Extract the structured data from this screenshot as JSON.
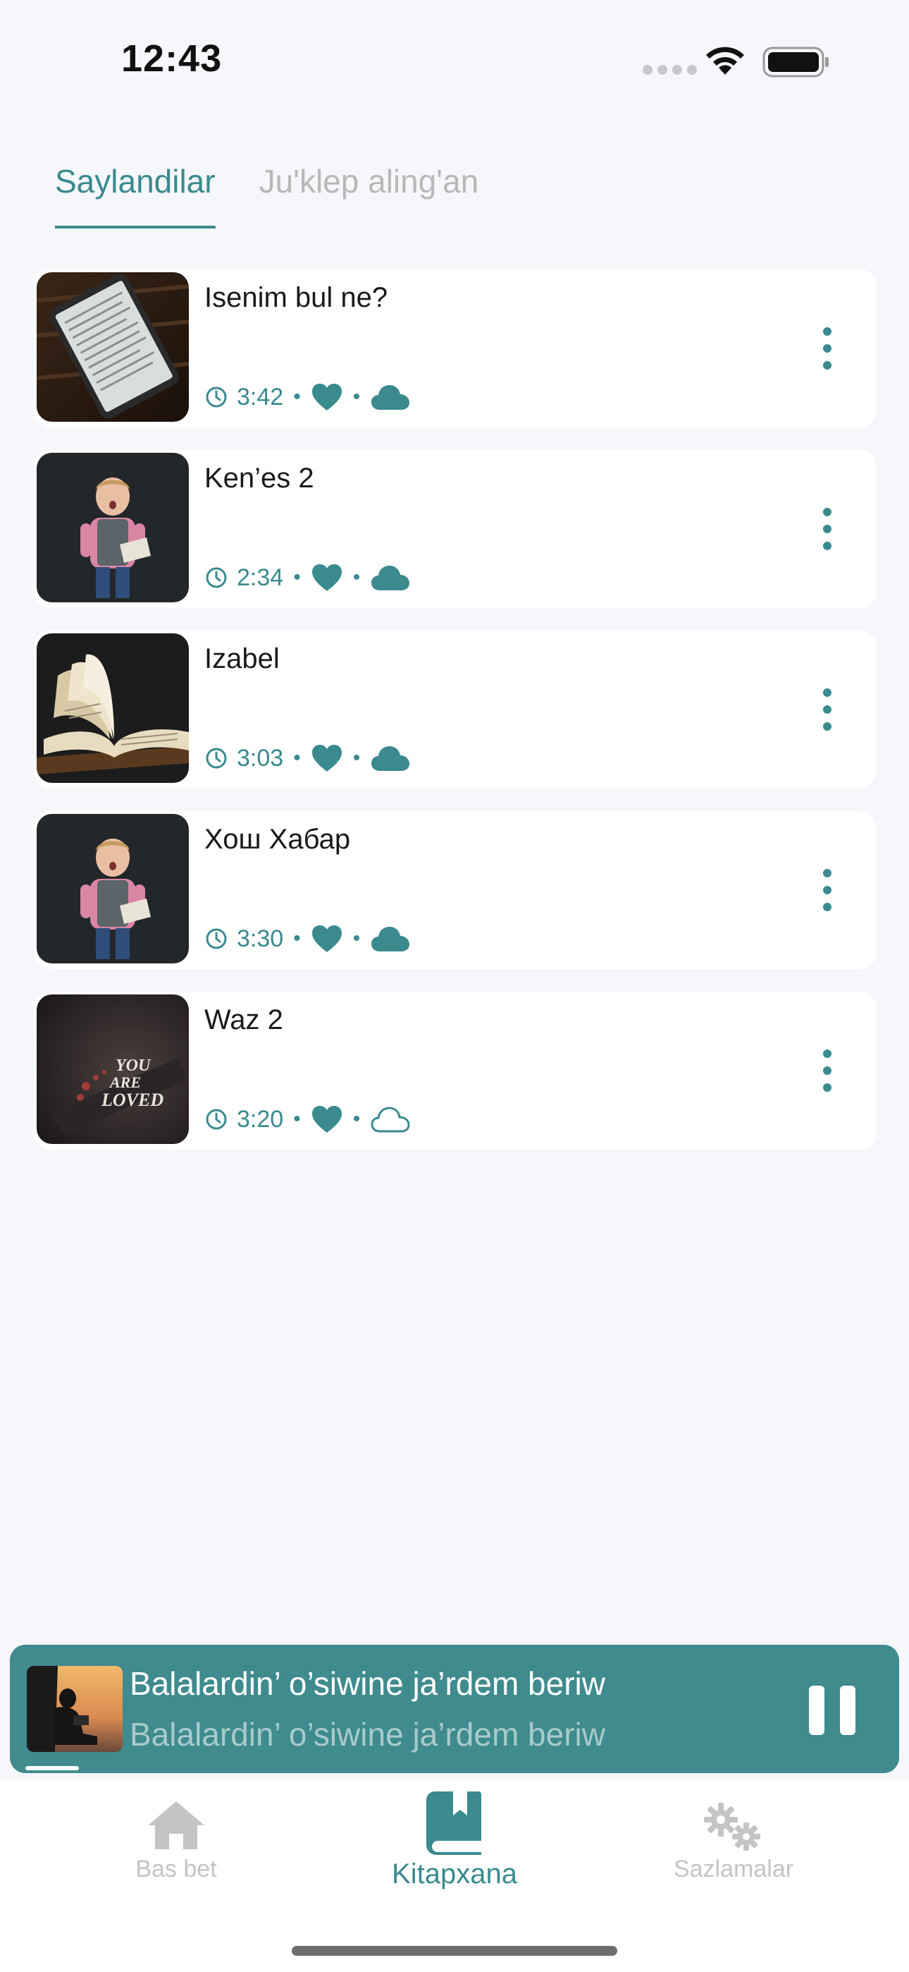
{
  "status_bar": {
    "time": "12:43"
  },
  "tabs": [
    {
      "label": "Saylandilar",
      "active": true
    },
    {
      "label": "Ju'klep aling'an",
      "active": false
    }
  ],
  "items": [
    {
      "title": "Isenim bul ne?",
      "duration": "3:42",
      "favorite": true,
      "downloaded": true,
      "thumb": "tablet-reading"
    },
    {
      "title": "Ken’es 2",
      "duration": "2:34",
      "favorite": true,
      "downloaded": true,
      "thumb": "boy-with-book"
    },
    {
      "title": "Izabel",
      "duration": "3:03",
      "favorite": true,
      "downloaded": true,
      "thumb": "open-book"
    },
    {
      "title": "Хош Хабар",
      "duration": "3:30",
      "favorite": true,
      "downloaded": true,
      "thumb": "boy-with-book"
    },
    {
      "title": "Waz 2",
      "duration": "3:20",
      "favorite": true,
      "downloaded": false,
      "thumb": "you-are-loved"
    }
  ],
  "player": {
    "title": "Balalardin’ o’siwine ja’rdem beriw",
    "subtitle": "Balalardin’ o’siwine ja’rdem beriw",
    "progress": 0.06,
    "state": "playing"
  },
  "nav": {
    "home": "Bas bet",
    "library": "Kitapxana",
    "settings": "Sazlamalar",
    "active": "library"
  },
  "colors": {
    "accent": "#3a8a8e",
    "inactive": "#c4c4c4",
    "player_bg": "#3f8b8e"
  }
}
